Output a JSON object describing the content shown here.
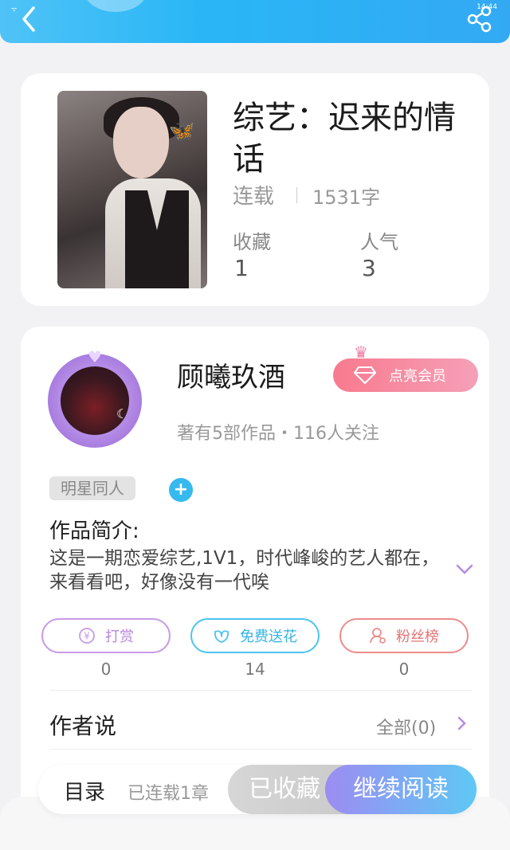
{
  "status_bar": {
    "time": "14:44"
  },
  "book": {
    "title": "综艺：迟来的情话",
    "status": "连载",
    "word_count": "1531字",
    "favorites_label": "收藏",
    "favorites_value": "1",
    "popularity_label": "人气",
    "popularity_value": "3"
  },
  "author": {
    "name": "顾曦玖酒",
    "vip_button": "点亮会员",
    "meta": "著有5部作品・116人关注",
    "tag": "明星同人"
  },
  "intro": {
    "label": "作品简介:",
    "text": "这是一期恋爱综艺,1V1，时代峰峻的艺人都在，来看看吧，好像没有一代唉"
  },
  "actions": [
    {
      "label": "打赏",
      "count": "0",
      "color": "#c79ae6",
      "icon": "yen-icon"
    },
    {
      "label": "免费送花",
      "count": "14",
      "color": "#4cc3ef",
      "icon": "flower-icon"
    },
    {
      "label": "粉丝榜",
      "count": "0",
      "color": "#ee8b8b",
      "icon": "fans-icon"
    }
  ],
  "author_says": {
    "label": "作者说",
    "all": "全部(0)"
  },
  "bottom_bar": {
    "catalog": "目录",
    "chapters": "已连载1章",
    "favorited": "已收藏",
    "continue": "继续阅读"
  },
  "colors": {
    "header": "#29b6f6",
    "accent_purple": "#9d8cf2",
    "vip_pink": "#f87a8e"
  }
}
